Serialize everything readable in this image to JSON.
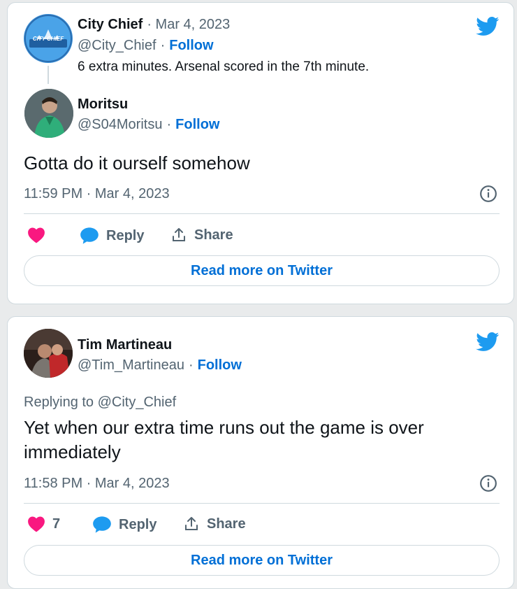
{
  "colors": {
    "accent": "#1d9bf0",
    "link": "#006fd6",
    "heart": "#f91880",
    "muted": "#536471"
  },
  "card1": {
    "quoted": {
      "name": "City Chief",
      "sep_date": "· Mar 4, 2023",
      "handle": "@City_Chief",
      "follow": "Follow",
      "text": "6 extra minutes. Arsenal scored in the 7th minute.",
      "logo_text": "CITY CHIEF"
    },
    "reply": {
      "name": "Moritsu",
      "handle": "@S04Moritsu",
      "follow": "Follow",
      "text": "Gotta do it ourself somehow",
      "time": "11:59 PM · Mar 4, 2023"
    },
    "actions": {
      "reply": "Reply",
      "share": "Share"
    },
    "read_more": "Read more on Twitter"
  },
  "card2": {
    "name": "Tim Martineau",
    "handle": "@Tim_Martineau",
    "follow": "Follow",
    "replying_to": "Replying to @City_Chief",
    "text": "Yet when our extra time runs out the game is over immediately",
    "time": "11:58 PM · Mar 4, 2023",
    "actions": {
      "like_count": "7",
      "reply": "Reply",
      "share": "Share"
    },
    "read_more": "Read more on Twitter"
  },
  "separators": {
    "dot": "·"
  }
}
